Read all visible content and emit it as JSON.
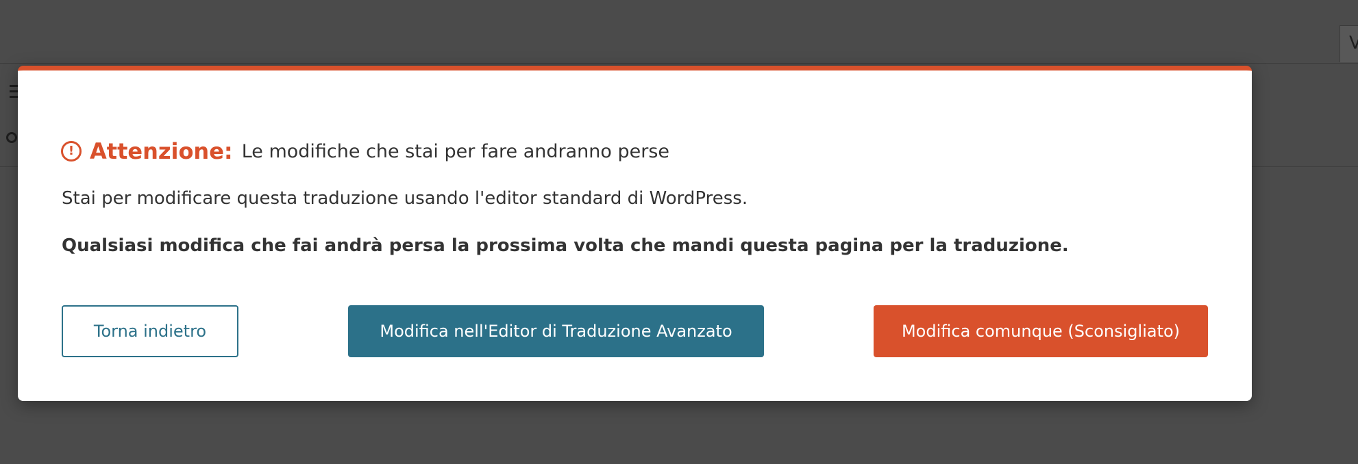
{
  "background": {
    "tab_label": "V"
  },
  "modal": {
    "warning_icon": "!",
    "heading_label": "Attenzione:",
    "heading_text": "Le modifiche che stai per fare andranno perse",
    "paragraph": "Stai per modificare questa traduzione usando l'editor standard di WordPress.",
    "bold_warning": "Qualsiasi modifica che fai andrà persa la prossima volta che mandi questa pagina per la traduzione.",
    "buttons": {
      "back": "Torna indietro",
      "advanced_editor": "Modifica nell'Editor di Traduzione Avanzato",
      "edit_anyway": "Modifica comunque (Sconsigliato)"
    }
  },
  "colors": {
    "accent_orange": "#d9512c",
    "accent_teal": "#2c7189",
    "overlay_gray": "#4b4b4b",
    "text": "#333333"
  },
  "icons": [
    "list-icon",
    "search-icon",
    "warning-circle-icon"
  ]
}
